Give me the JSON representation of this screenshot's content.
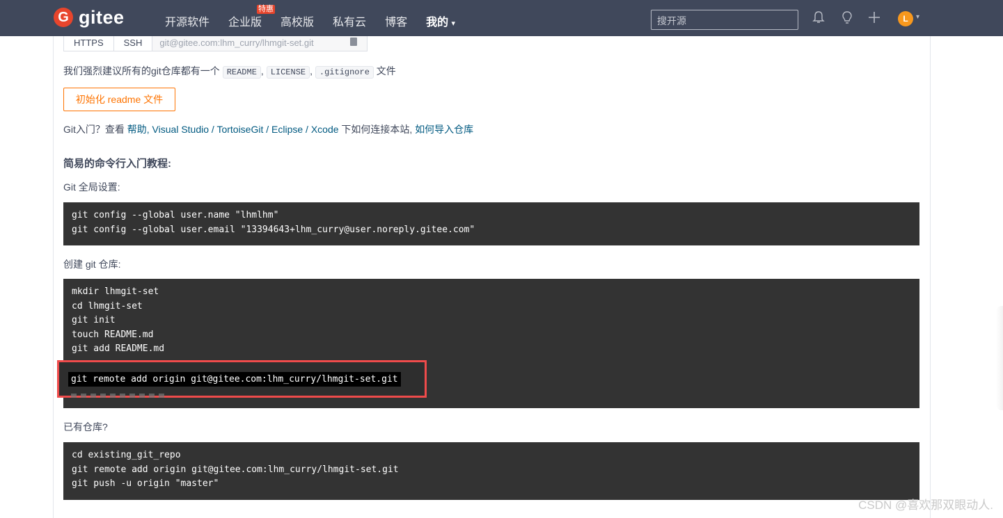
{
  "header": {
    "logo_glyph": "G",
    "logo_text": "gitee",
    "nav": [
      {
        "label": "开源软件"
      },
      {
        "label": "企业版",
        "badge": "特惠"
      },
      {
        "label": "高校版"
      },
      {
        "label": "私有云"
      },
      {
        "label": "博客"
      },
      {
        "label": "我的",
        "caret": "▾"
      }
    ],
    "search_placeholder": "搜开源",
    "icons": [
      "bell-icon",
      "lightbulb-icon",
      "plus-icon"
    ],
    "avatar_initial": "L",
    "avatar_color": "#f8981d",
    "bg_color": "#40485b",
    "brand_color": "#e8452c"
  },
  "clone": {
    "tabs": [
      "HTTPS",
      "SSH"
    ],
    "url": "git@gitee.com:lhm_curry/lhmgit-set.git"
  },
  "recommend": {
    "prefix": "我们强烈建议所有的git仓库都有一个",
    "files": [
      "README",
      "LICENSE",
      ".gitignore"
    ],
    "suffix": "文件",
    "sep": ","
  },
  "init_button": "初始化 readme 文件",
  "help": {
    "prefix": "Git入门？查看 ",
    "help_link": "帮助",
    "tools": ", Visual Studio / TortoiseGit / Eclipse / Xcode",
    "middle": " 下如何连接本站, ",
    "import_link": "如何导入仓库"
  },
  "tutorial": {
    "heading": "简易的命令行入门教程:",
    "global_label": "Git 全局设置:",
    "global_code": "git config --global user.name \"lhmlhm\"\ngit config --global user.email \"13394643+lhm_curry@user.noreply.gitee.com\"",
    "create_label": "创建 git 仓库:",
    "create_code": "mkdir lhmgit-set\ncd lhmgit-set\ngit init\ntouch README.md\ngit add README.md",
    "highlighted_command": "git remote add origin git@gitee.com:lhm_curry/lhmgit-set.git",
    "existing_label": "已有仓库?",
    "existing_code": "cd existing_git_repo\ngit remote add origin git@gitee.com:lhm_curry/lhmgit-set.git\ngit push -u origin \"master\""
  },
  "watermark": "CSDN @喜欢那双眼动人.",
  "colors": {
    "accent_orange": "#fe7300",
    "link_blue": "#005980",
    "code_bg": "#333333",
    "highlight_border": "#ef4b4b"
  }
}
